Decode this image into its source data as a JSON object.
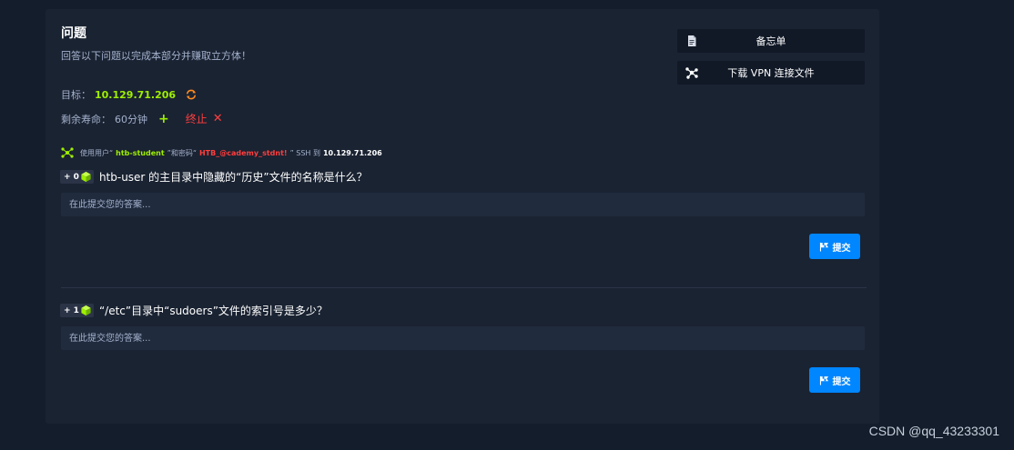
{
  "section": {
    "title": "问题",
    "subtitle": "回答以下问题以完成本部分并赚取立方体！"
  },
  "target": {
    "label": "目标：",
    "ip": "10.129.71.206"
  },
  "life": {
    "label": "剩余寿命：",
    "value": "60分钟",
    "stop_label": "终止"
  },
  "side_buttons": {
    "cheatsheet": "备忘单",
    "vpn": "下载 VPN 连接文件"
  },
  "ssh": {
    "prefix": "使用用户“",
    "user": "htb-student",
    "mid": "”和密码“",
    "password": "HTB_@cademy_stdnt!",
    "suffix": "” SSH 到",
    "ip": "10.129.71.206"
  },
  "questions": [
    {
      "points": "+ 0",
      "text": "htb-user 的主目录中隐藏的“历史”文件的名称是什么？",
      "placeholder": "在此提交您的答案...",
      "submit_label": "提交"
    },
    {
      "points": "+ 1",
      "text": "“/etc”目录中“sudoers”文件的索引号是多少？",
      "placeholder": "在此提交您的答案...",
      "submit_label": "提交"
    }
  ],
  "watermark": "CSDN @qq_43233301",
  "colors": {
    "accent_green": "#9fef00",
    "accent_red": "#ff3e3e",
    "submit_blue": "#0086ff",
    "panel_bg": "#1a2332",
    "page_bg": "#141d2b"
  }
}
